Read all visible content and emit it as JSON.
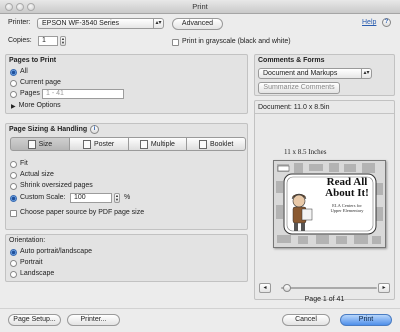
{
  "window": {
    "title": "Print"
  },
  "top": {
    "printer_label": "Printer:",
    "printer_value": "EPSON WF-3540 Series",
    "advanced_label": "Advanced",
    "help_label": "Help",
    "copies_label": "Copies:",
    "copies_value": "1",
    "grayscale_label": "Print in grayscale (black and white)"
  },
  "pages": {
    "heading": "Pages to Print",
    "all": "All",
    "current": "Current page",
    "pages": "Pages",
    "pages_placeholder": "1 - 41",
    "more": "More Options"
  },
  "sizing": {
    "heading": "Page Sizing & Handling",
    "tabs": [
      "Size",
      "Poster",
      "Multiple",
      "Booklet"
    ],
    "fit": "Fit",
    "actual": "Actual size",
    "shrink": "Shrink oversized pages",
    "custom": "Custom Scale:",
    "scale_value": "100",
    "percent": "%",
    "pdf_source": "Choose paper source by PDF page size"
  },
  "orientation": {
    "heading": "Orientation:",
    "auto": "Auto portrait/landscape",
    "portrait": "Portrait",
    "landscape": "Landscape"
  },
  "comments": {
    "heading": "Comments & Forms",
    "value": "Document and Markups",
    "summarize": "Summarize Comments"
  },
  "preview": {
    "doc_size": "Document: 11.0 x 8.5in",
    "page_size": "11 x 8.5 Inches",
    "title_line1": "Read All",
    "title_line2": "About It!",
    "subtitle1": "ELA Centers for",
    "subtitle2": "Upper Elementary",
    "page_counter": "Page 1 of 41"
  },
  "bottom": {
    "page_setup": "Page Setup...",
    "printer": "Printer...",
    "cancel": "Cancel",
    "print": "Print"
  }
}
